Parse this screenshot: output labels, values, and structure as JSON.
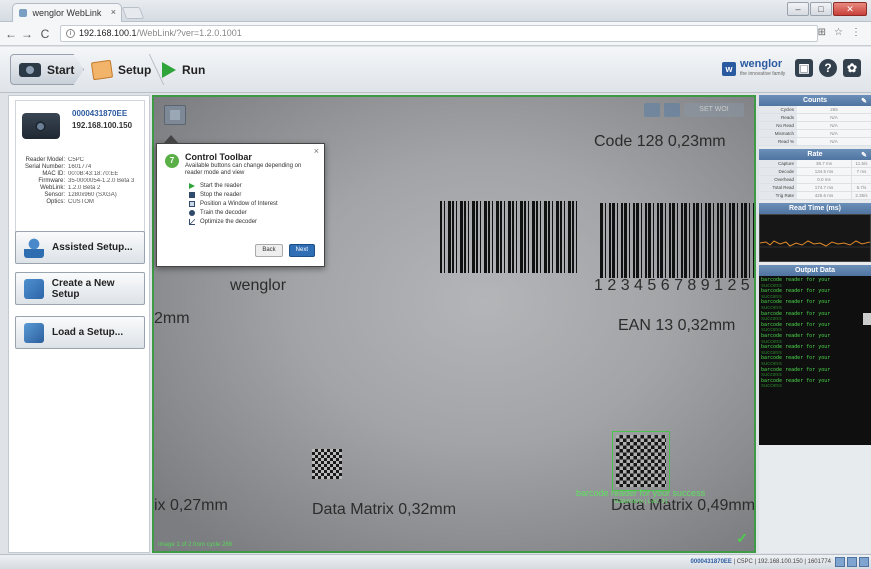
{
  "browser": {
    "tab_title": "wenglor WebLink",
    "tab_close": "×",
    "address_host": "192.168.100.1",
    "address_path": "/WebLink/?ver=1.2.0.1001",
    "addr_icons": [
      "⊞",
      "☆",
      "⋮"
    ],
    "window_buttons": [
      "–",
      "□",
      "✕"
    ]
  },
  "toolbar": {
    "start_label": "Start",
    "setup_label": "Setup",
    "run_label": "Run",
    "logo_text": "wenglor",
    "logo_sub": "the innovative family",
    "help_glyph": "?",
    "settings_glyph": "✿",
    "icons": [
      "camera-icon",
      "setup-icon",
      "play-icon",
      "wenglor-logo-icon",
      "reader-icon",
      "help-icon",
      "settings-icon"
    ]
  },
  "reader": {
    "id": "0000431870EE",
    "ip": "192.168.100.150",
    "info": [
      {
        "key": "Reader Model:",
        "value": "C5PC"
      },
      {
        "key": "Serial Number:",
        "value": "1601774"
      },
      {
        "key": "MAC ID:",
        "value": "00:0B:43:18:70:EE"
      },
      {
        "key": "Firmware:",
        "value": "35-0000054-1.2.0 Beta 3"
      },
      {
        "key": "WebLink:",
        "value": "1.2.0 Beta 2"
      },
      {
        "key": "Sensor:",
        "value": "1280x960 (SXGA)"
      },
      {
        "key": "Optics:",
        "value": "CUSTOM"
      }
    ]
  },
  "side_buttons": {
    "assisted": "Assisted Setup...",
    "create": "Create a New Setup",
    "load": "Load a Setup..."
  },
  "camera": {
    "texts": {
      "code128": "Code 128 0,23mm",
      "wenglor": "wenglor",
      "digits": "1  2 3 4 5 6 7   8 9 1 2 5",
      "ean13": "EAN 13 0,32mm",
      "left_mm": "2mm",
      "dm027": "ix 0,27mm",
      "dm032": "Data Matrix 0,32mm",
      "dm049": "Data Matrix 0,49mm"
    },
    "decode_text": "barcode reader for your success",
    "decode_sub": "Datamatrix | Len: 31",
    "image_status": "Image 1 of 2 from cycle 266",
    "check": "✓",
    "ctrl_label": "SET WOI"
  },
  "popup": {
    "number": "7",
    "title": "Control Toolbar",
    "description": "Available buttons can change depending on reader mode and view",
    "items": [
      "Start the reader",
      "Stop the reader",
      "Position a Window of Interest",
      "Train the decoder",
      "Optimize the decoder"
    ],
    "back_label": "Back",
    "next_label": "Next",
    "close": "×"
  },
  "counts": {
    "title": "Counts",
    "rows": [
      {
        "key": "Cycles",
        "value": "265"
      },
      {
        "key": "Reads",
        "value": "N/A"
      },
      {
        "key": "No Read",
        "value": "N/A"
      },
      {
        "key": "Mismatch",
        "value": "N/A"
      },
      {
        "key": "Read %",
        "value": "N/A"
      }
    ]
  },
  "rate": {
    "title": "Rate",
    "rows": [
      {
        "key": "Capture",
        "value": "38.7 ms",
        "value2": "11.5/s"
      },
      {
        "key": "Decode",
        "value": "134.5 ms",
        "value2": "7 ms"
      },
      {
        "key": "Overhead",
        "value": "0.0 ms",
        "value2": ""
      },
      {
        "key": "Total Read",
        "value": "174.7 ms",
        "value2": "5.7/s"
      },
      {
        "key": "Trig Rate",
        "value": "425.6 ms",
        "value2": "2.35/s"
      }
    ]
  },
  "read_time": {
    "title": "Read Time (ms)"
  },
  "output": {
    "title": "Output Data",
    "lines": [
      {
        "text": "barcode reader for your",
        "sub": "success"
      },
      {
        "text": "barcode reader for your",
        "sub": "success"
      },
      {
        "text": "barcode reader for your",
        "sub": "success"
      },
      {
        "text": "barcode reader for your",
        "sub": "success"
      },
      {
        "text": "barcode reader for your",
        "sub": "success"
      },
      {
        "text": "barcode reader for your",
        "sub": "success"
      },
      {
        "text": "barcode reader for your",
        "sub": "success"
      },
      {
        "text": "barcode reader for your",
        "sub": "success"
      },
      {
        "text": "barcode reader for your",
        "sub": "success"
      },
      {
        "text": "barcode reader for your",
        "sub": "success"
      }
    ]
  },
  "status_bar": {
    "reader_id": "0000431870EE",
    "rest": "| C5PC | 192.168.100.150 | 1601774"
  },
  "colors": {
    "accent": "#2a5aa0",
    "camera_border": "#3e9a44",
    "decode_green": "#62e062"
  }
}
